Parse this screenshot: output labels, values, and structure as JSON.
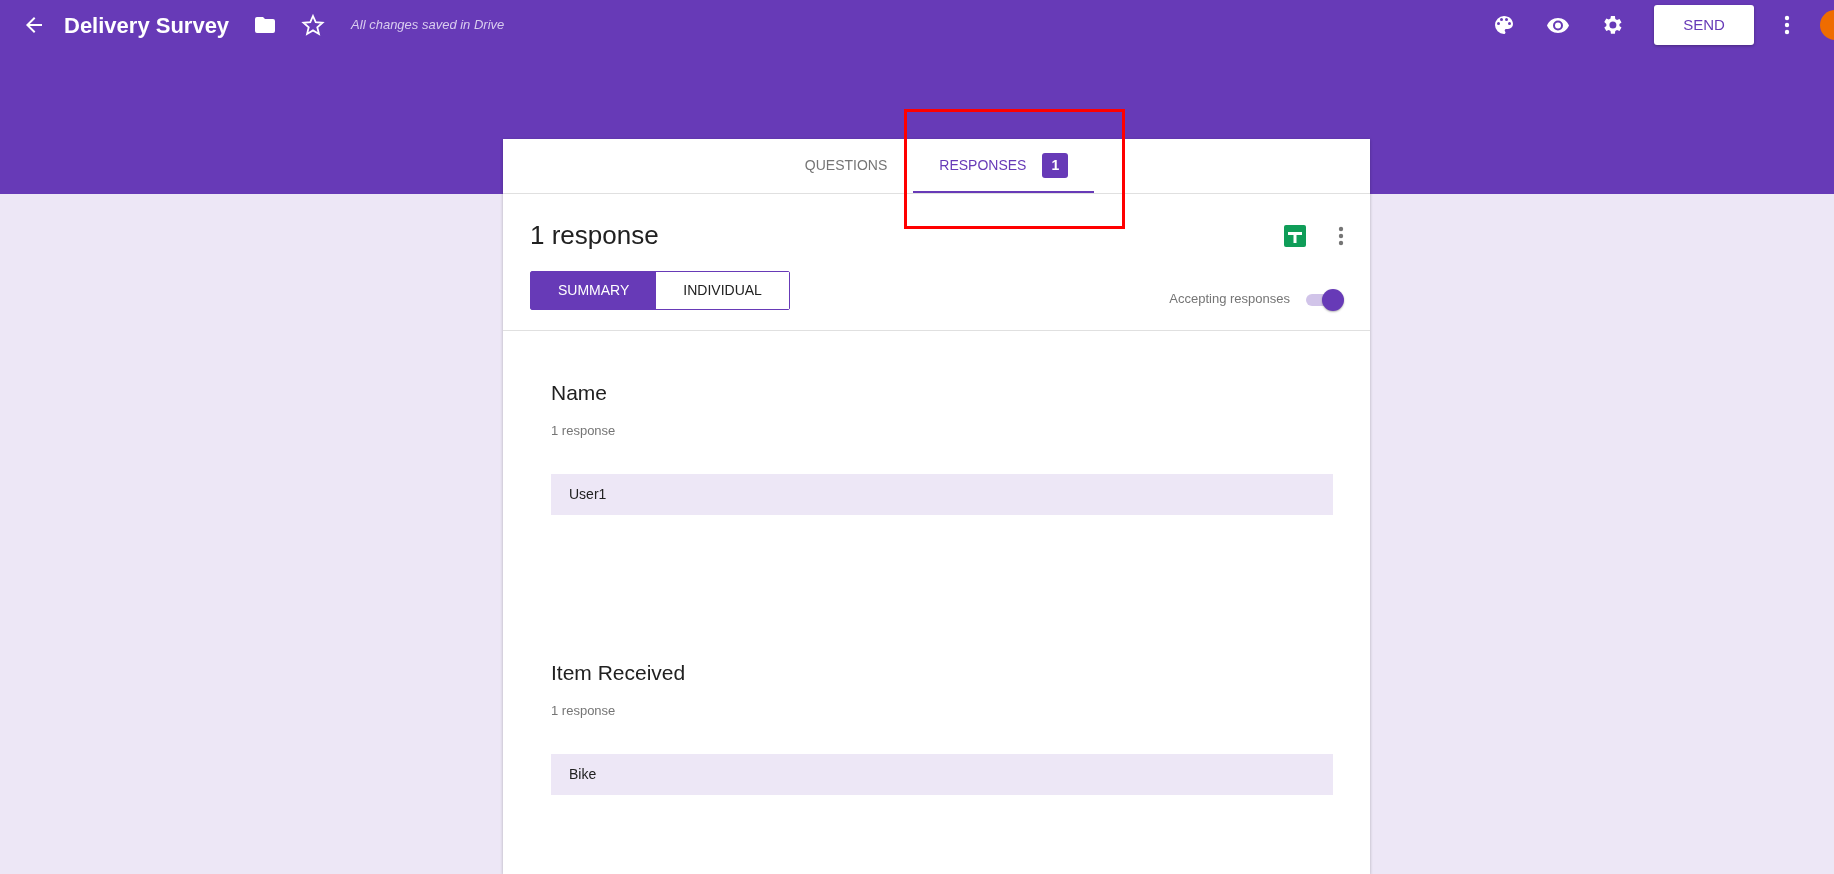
{
  "app_bar": {
    "title": "Delivery Survey",
    "save_status": "All changes saved in Drive",
    "send_button": "SEND"
  },
  "tabs": [
    {
      "label": "QUESTIONS",
      "selected": false
    },
    {
      "label": "RESPONSES",
      "selected": true,
      "count": "1"
    }
  ],
  "responses": {
    "heading": "1 response",
    "views": [
      {
        "label": "SUMMARY",
        "selected": true
      },
      {
        "label": "INDIVIDUAL",
        "selected": false
      }
    ],
    "accepting": {
      "label": "Accepting responses",
      "on": true
    }
  },
  "questions": [
    {
      "title": "Name",
      "count": "1 response",
      "answers": [
        "User1"
      ]
    },
    {
      "title": "Item Received",
      "count": "1 response",
      "answers": [
        "Bike"
      ]
    }
  ]
}
